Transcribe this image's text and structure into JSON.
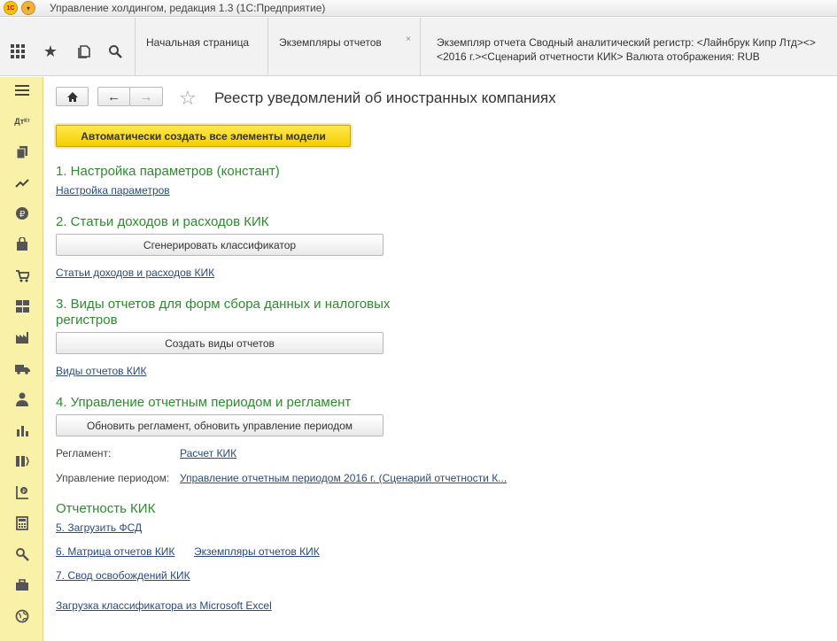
{
  "window": {
    "title": "Управление холдингом, редакция 1.3  (1С:Предприятие)",
    "logo_text": "1С"
  },
  "topnav": {
    "icons": [
      "apps-grid-icon",
      "star-icon",
      "history-icon",
      "search-icon"
    ],
    "tabs": [
      {
        "label": "Начальная страница",
        "close": ""
      },
      {
        "label": "Экземпляры отчетов",
        "close": "×"
      },
      {
        "label": "Экземпляр отчета Сводный аналитический регистр: <Лайнбрук Кипр Лтд><><2016 г.><Сценарий отчетности КИК> Валюта отображения: RUB",
        "close": ""
      }
    ]
  },
  "sidebar": {
    "icons": [
      "menu-icon",
      "accounting-icon",
      "documents-icon",
      "chart-trend-icon",
      "ruble-icon",
      "bag-icon",
      "cart-icon",
      "grid-icon",
      "factory-icon",
      "truck-icon",
      "person-icon",
      "bar-chart-icon",
      "money-icon",
      "finance-icon",
      "calculator-icon",
      "settings-icon",
      "briefcase-icon",
      "globe-icon"
    ]
  },
  "page": {
    "title": "Реестр уведомлений об иностранных компаниях",
    "nav_home": "home-icon",
    "nav_back": "←",
    "nav_forward": "→",
    "star": "☆",
    "auto_button": "Автоматически создать все элементы модели",
    "section1": "1. Настройка параметров (констант)",
    "link1": "Настройка параметров",
    "section2": "2. Статьи доходов и расходов КИК",
    "button2": "Сгенерировать классификатор",
    "link2": "Статьи доходов и расходов КИК",
    "section3_line1": "3. Виды отчетов для форм сбора данных и налоговых",
    "section3_line2": "регистров",
    "button3": "Создать виды отчетов",
    "link3": "Виды отчетов КИК",
    "section4": "4. Управление отчетным периодом и регламент",
    "button4": "Обновить регламент, обновить  управление периодом",
    "reglament_label": "Регламент:",
    "reglament_link": "Расчет КИК",
    "period_label": "Управление периодом:",
    "period_link": "Управление отчетным периодом 2016 г. (Сценарий отчетности К...",
    "section5": "Отчетность КИК",
    "link5": "5. Загрузить ФСД",
    "link6": "6. Матрица отчетов КИК",
    "link6b": "Экземпляры отчетов КИК",
    "link7": "7. Свод освобождений КИК",
    "link8": "Загрузка классификатора из Microsoft Excel"
  }
}
